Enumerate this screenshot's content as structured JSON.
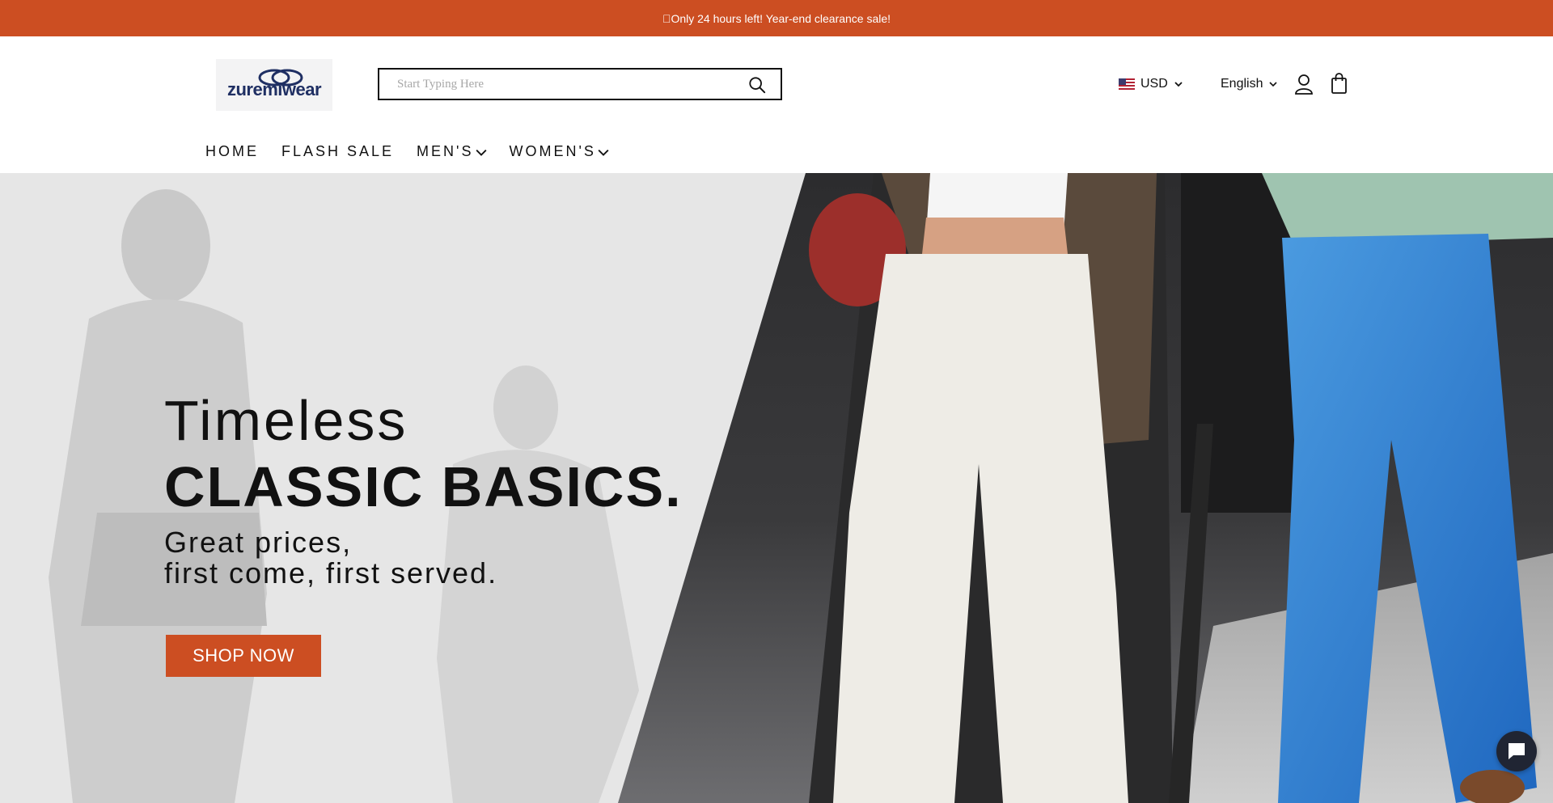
{
  "announcement": {
    "text": "\u0000Only 24 hours left! Year-end clearance sale!"
  },
  "header": {
    "logo_text": "zuremiwear",
    "search": {
      "placeholder": "Start Typing Here",
      "value": ""
    },
    "currency": {
      "label": "USD",
      "icon": "us-flag-icon"
    },
    "language": {
      "label": "English"
    },
    "icons": [
      "search-icon",
      "user-icon",
      "shopping-bag-icon"
    ]
  },
  "nav": {
    "items": [
      {
        "label": "HOME"
      },
      {
        "label": "FLASH SALE"
      },
      {
        "label": "MEN'S",
        "has_dropdown": true
      },
      {
        "label": "WOMEN'S",
        "has_dropdown": true
      }
    ]
  },
  "hero": {
    "line1": "Timeless",
    "line2": "CLASSIC BASICS.",
    "sub1": "Great prices,",
    "sub2": "first come, first served.",
    "cta": "SHOP NOW"
  },
  "chat": {
    "icon": "chat-icon"
  },
  "colors": {
    "accent": "#cc4e22",
    "logo": "#1f2f63",
    "chat_bg": "#202533"
  }
}
